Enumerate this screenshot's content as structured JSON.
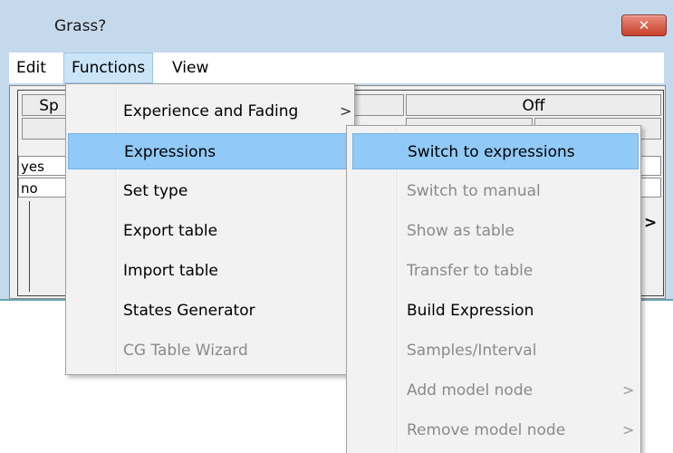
{
  "window": {
    "title": "Grass?",
    "close_glyph": "✕"
  },
  "menubar": {
    "items": [
      "Edit",
      "Functions",
      "View"
    ]
  },
  "grid": {
    "headers": [
      "Sp",
      "Off"
    ],
    "rows": [
      "yes",
      "no"
    ],
    "scroll_glyph": ">"
  },
  "functions_menu": {
    "items": [
      {
        "label": "Experience and Fading",
        "arrow": ">",
        "enabled": true
      },
      {
        "label": "Expressions",
        "arrow": ">",
        "enabled": true,
        "highlighted": true
      },
      {
        "label": "Set type",
        "arrow": ">",
        "enabled": true
      },
      {
        "label": "Export table",
        "enabled": true
      },
      {
        "label": "Import table",
        "enabled": true
      },
      {
        "label": "States Generator",
        "enabled": true
      },
      {
        "label": "CG Table Wizard",
        "enabled": false
      }
    ]
  },
  "expressions_menu": {
    "items": [
      {
        "label": "Switch to expressions",
        "enabled": true,
        "highlighted": true
      },
      {
        "label": "Switch to manual",
        "enabled": false
      },
      {
        "label": "Show as table",
        "enabled": false
      },
      {
        "label": "Transfer to table",
        "enabled": false
      },
      {
        "label": "Build Expression",
        "enabled": true
      },
      {
        "label": "Samples/Interval",
        "enabled": false
      },
      {
        "label": "Add model node",
        "arrow": ">",
        "enabled": false
      },
      {
        "label": "Remove model node",
        "arrow": ">",
        "enabled": false
      }
    ]
  },
  "colors": {
    "titlebar": "#c5d9ec",
    "menu_bg": "#f2f2f2",
    "highlight": "#91c9f7",
    "disabled_text": "#8a8a8a",
    "close_button": "#c9402c"
  }
}
